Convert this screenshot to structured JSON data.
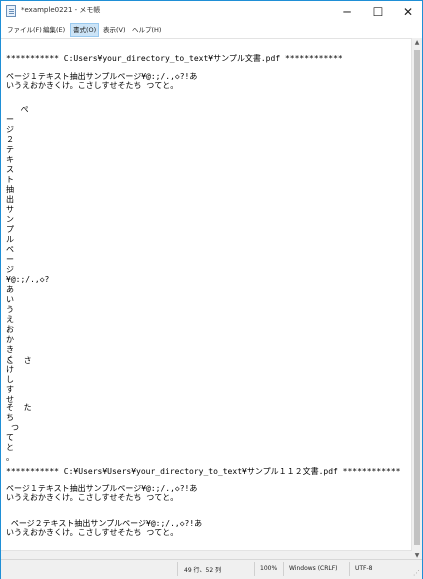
{
  "window": {
    "title": "*example0221 - メモ帳",
    "minimize": "─",
    "maximize": "☐",
    "close": "✕"
  },
  "menu": [
    "ファイル(F)",
    "編集(E)",
    "書式(O)",
    "表示(V)",
    "ヘルプ(H)"
  ],
  "editor": {
    "lines": [
      "*********** C:Users¥your_directory_to_text¥サンプル文書.pdf ************",
      "ページ１テキスト抽出サンプルページ¥@:;/.,◇?!あ",
      "いうえおかきくけ。こさしすせそたち つてと。",
      "   ぺ",
      "ー",
      "ジ",
      "２",
      "テ",
      "キ",
      "ス",
      "ト",
      "抽",
      "出",
      "サ",
      "ン",
      "プ",
      "ル",
      "ペ",
      "ー",
      "ジ",
      "¥@:;/.,◇?",
      "あ",
      "い",
      "う",
      "え",
      "お",
      "か",
      "き",
      "く",
      "け",
      "こ  さ",
      "",
      "し",
      "す",
      "せ",
      "そ  た",
      "ち",
      "つ",
      "て",
      "と",
      "。",
      "*********** C:¥Users¥Users¥your_directory_to_text¥サンプル１１２文書.pdf ************",
      "ページ１テキスト抽出サンプルページ¥@:;/.,◇?!あ",
      "いうえおかきくけ。こさしすせそたち つてと。",
      " ページ２テキスト抽出サンプルページ¥@:;/.,◇?!あ",
      "いうえおかきくけ。こさしすせそたち つてと。"
    ]
  },
  "status": {
    "position": "49 行、52 列",
    "zoom": "100%",
    "line_ending": "Windows (CRLF)",
    "encoding": "UTF-8"
  }
}
